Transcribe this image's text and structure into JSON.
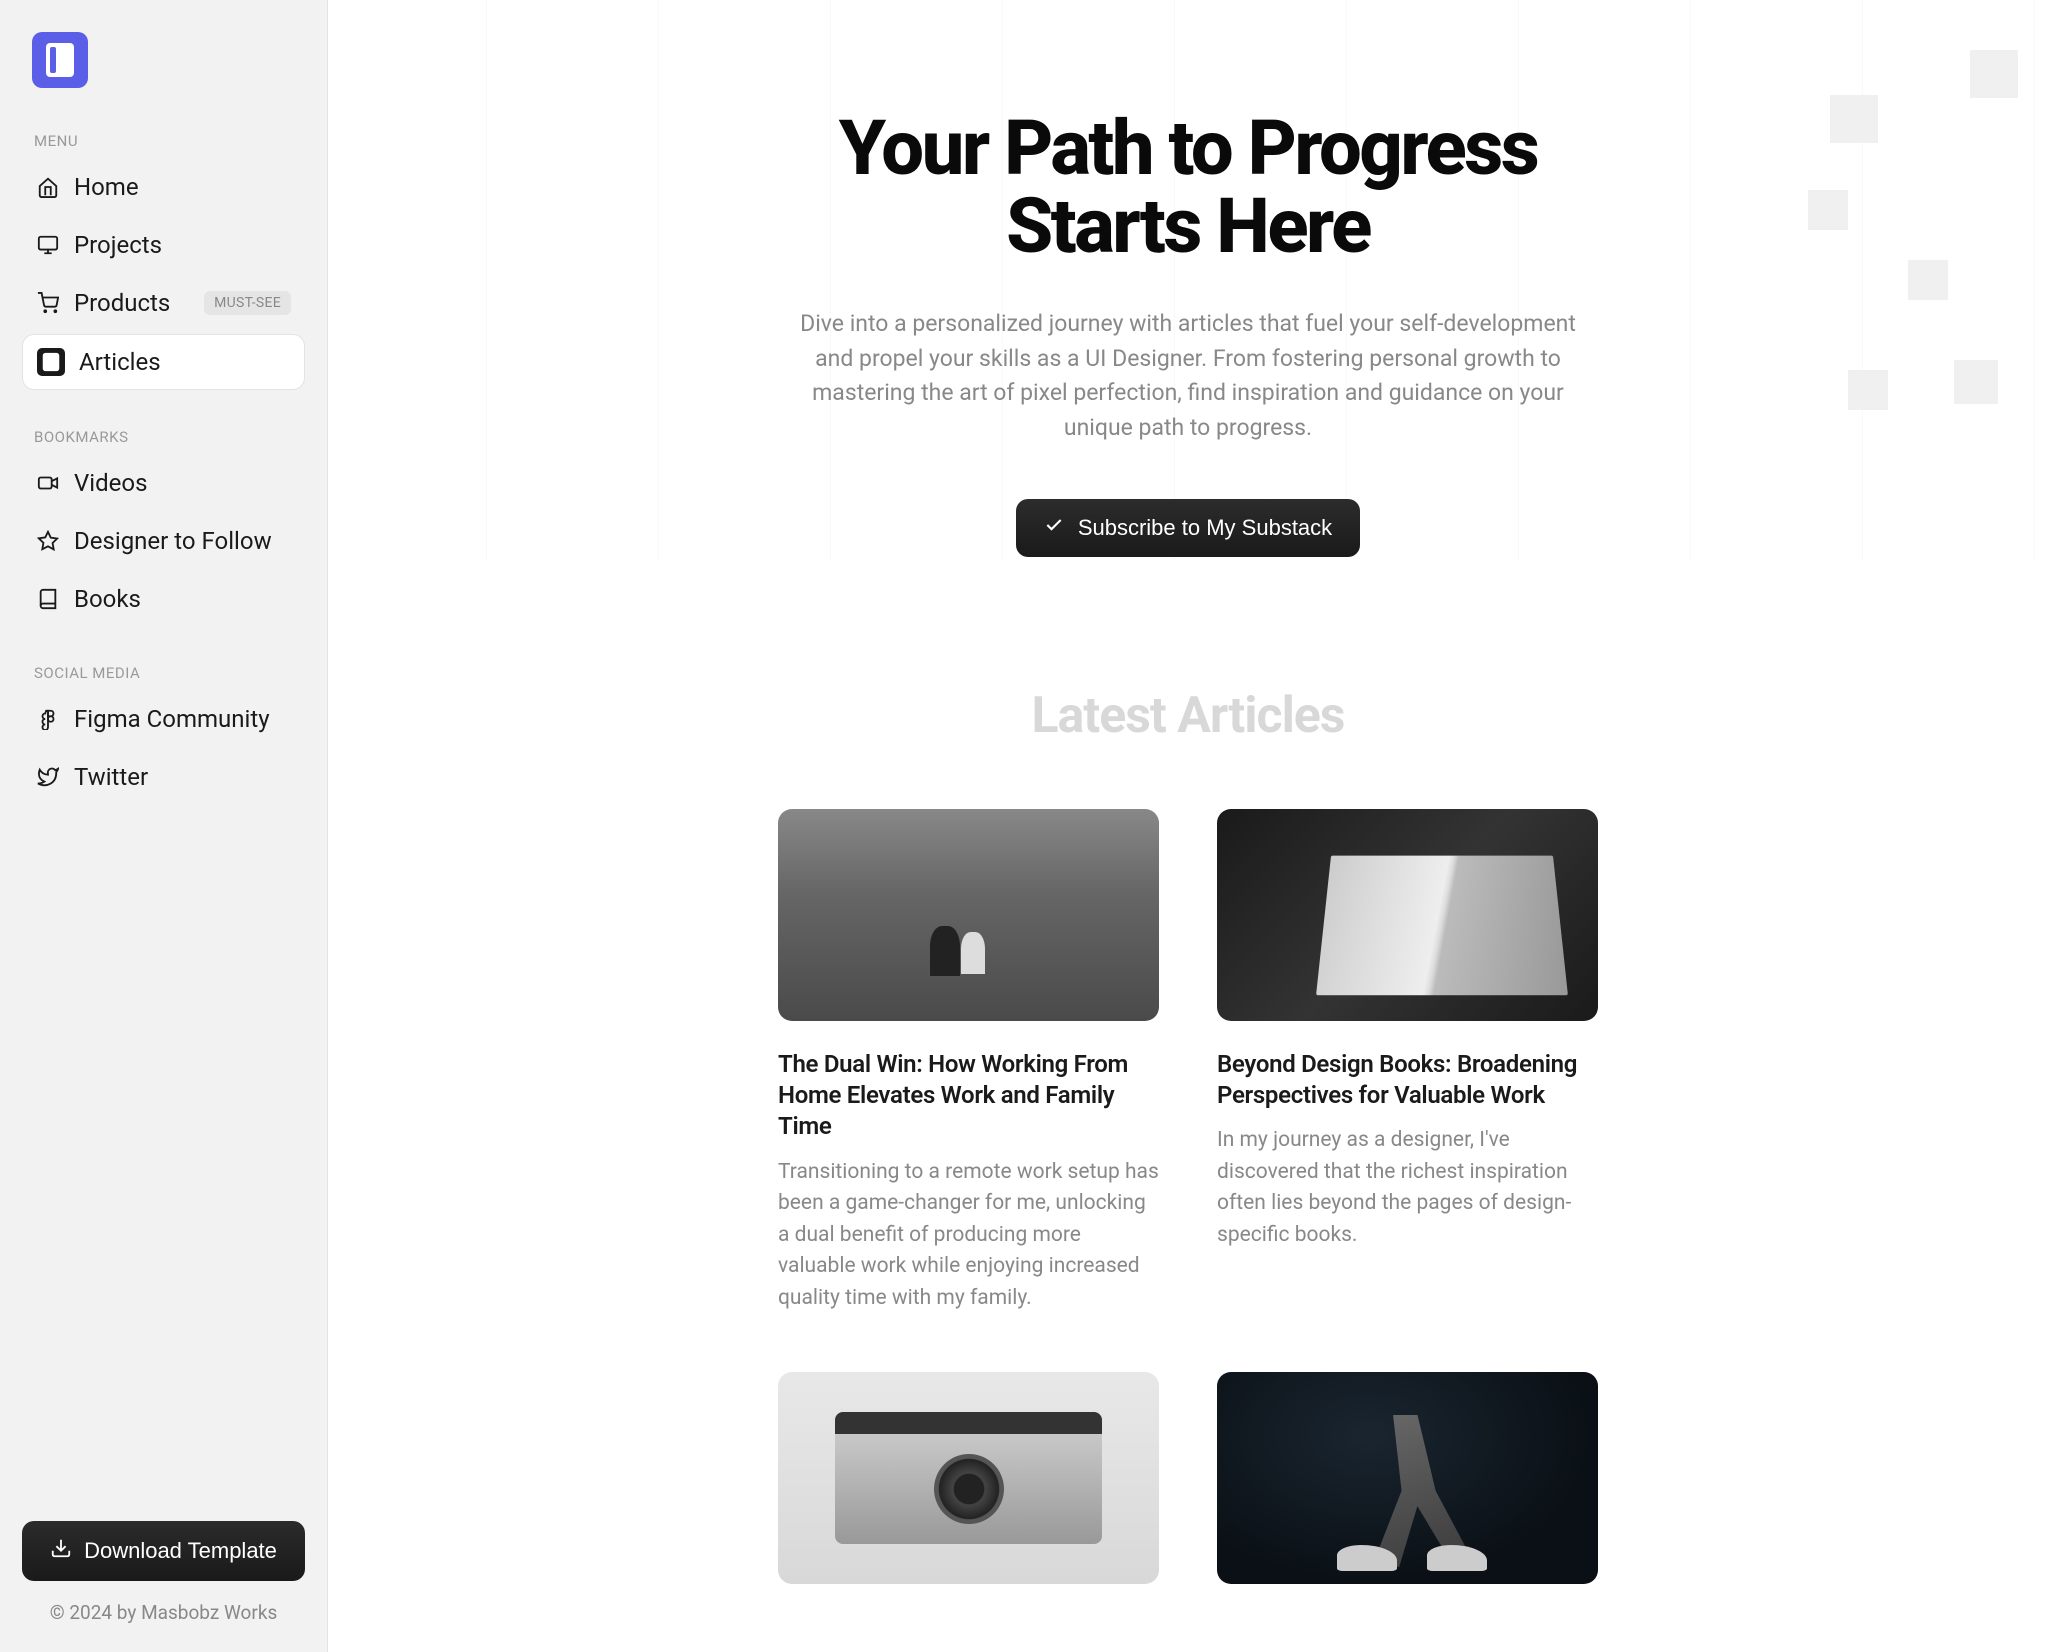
{
  "sidebar": {
    "sections": {
      "menu": {
        "label": "MENU",
        "items": [
          {
            "label": "Home",
            "icon": "home-icon"
          },
          {
            "label": "Projects",
            "icon": "monitor-icon"
          },
          {
            "label": "Products",
            "icon": "cart-icon",
            "badge": "MUST-SEE"
          },
          {
            "label": "Articles",
            "icon": "article-icon",
            "active": true
          }
        ]
      },
      "bookmarks": {
        "label": "BOOKMARKS",
        "items": [
          {
            "label": "Videos",
            "icon": "video-icon"
          },
          {
            "label": "Designer to Follow",
            "icon": "star-icon"
          },
          {
            "label": "Books",
            "icon": "book-icon"
          }
        ]
      },
      "social": {
        "label": "SOCIAL MEDIA",
        "items": [
          {
            "label": "Figma Community",
            "icon": "figma-icon"
          },
          {
            "label": "Twitter",
            "icon": "twitter-icon"
          }
        ]
      }
    },
    "download_label": "Download Template",
    "copyright": "© 2024 by Masbobz Works"
  },
  "hero": {
    "title": "Your Path to Progress Starts Here",
    "subtitle": "Dive into a personalized journey with articles that fuel your self-development and propel your skills as a UI Designer. From fostering personal growth to mastering the art of pixel perfection, find inspiration and guidance on your unique path to progress.",
    "cta_label": "Subscribe to My Substack"
  },
  "latest": {
    "heading": "Latest Articles",
    "articles": [
      {
        "title": "The Dual Win: How Working From Home Elevates Work and Family Time",
        "excerpt": "Transitioning to a remote work setup has been a game-changer for me, unlocking a dual benefit of producing more valuable work while enjoying increased quality time with my family."
      },
      {
        "title": "Beyond Design Books: Broadening Perspectives for Valuable Work",
        "excerpt": "In my journey as a designer, I've discovered that the richest inspiration often lies beyond the pages of design-specific books."
      },
      {
        "title": "",
        "excerpt": ""
      },
      {
        "title": "",
        "excerpt": ""
      }
    ]
  }
}
